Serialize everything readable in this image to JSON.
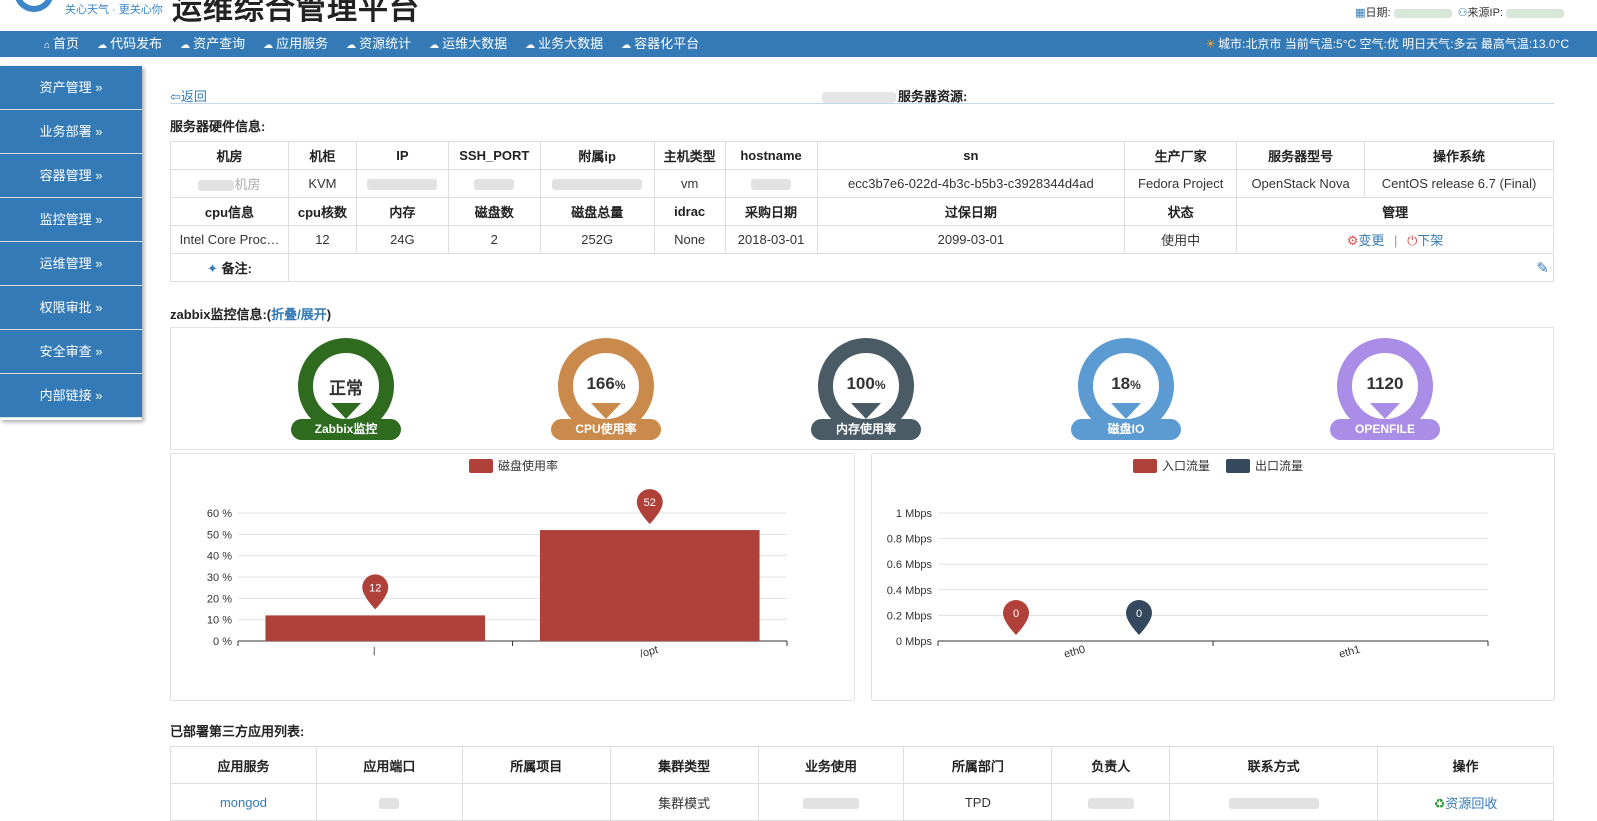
{
  "header": {
    "slogan": "关心天气 · 更关心你",
    "title": "运维综合管理平台",
    "date_label": "日期:",
    "ip_label": "来源IP:"
  },
  "nav": [
    {
      "label": "首页",
      "icon": "home-icon"
    },
    {
      "label": "代码发布",
      "icon": "cloud-icon"
    },
    {
      "label": "资产查询",
      "icon": "cloud-icon"
    },
    {
      "label": "应用服务",
      "icon": "cloud-icon"
    },
    {
      "label": "资源统计",
      "icon": "cloud-icon"
    },
    {
      "label": "运维大数据",
      "icon": "cloud-icon"
    },
    {
      "label": "业务大数据",
      "icon": "cloud-icon"
    },
    {
      "label": "容器化平台",
      "icon": "cloud-icon"
    }
  ],
  "weather": "城市:北京市  当前气温:5°C  空气:优  明日天气:多云  最高气温:13.0°C",
  "sidebar": [
    {
      "label": "资产管理"
    },
    {
      "label": "业务部署"
    },
    {
      "label": "容器管理"
    },
    {
      "label": "监控管理"
    },
    {
      "label": "运维管理"
    },
    {
      "label": "权限审批"
    },
    {
      "label": "安全审查"
    },
    {
      "label": "内部链接"
    }
  ],
  "back": "返回",
  "resource_title": "服务器资源:",
  "hw": {
    "title": "服务器硬件信息:",
    "h1": [
      "机房",
      "机柜",
      "IP",
      "SSH_PORT",
      "附属ip",
      "主机类型",
      "hostname",
      "sn",
      "生产厂家",
      "服务器型号",
      "操作系统"
    ],
    "r1": {
      "room_suffix": "机房",
      "cabinet": "KVM",
      "type": "vm",
      "sn": "ecc3b7e6-022d-4b3c-b5b3-c3928344d4ad",
      "vendor": "Fedora Project",
      "model": "OpenStack Nova",
      "os": "CentOS release 6.7 (Final)"
    },
    "h2": [
      "cpu信息",
      "cpu核数",
      "内存",
      "磁盘数",
      "磁盘总量",
      "idrac",
      "采购日期",
      "过保日期",
      "状态",
      "管理"
    ],
    "r2": {
      "cpu": "Intel Core Proc…",
      "cores": "12",
      "mem": "24G",
      "disks": "2",
      "disk_total": "252G",
      "idrac": "None",
      "buy": "2018-03-01",
      "warranty": "2099-03-01",
      "status": "使用中",
      "change": "变更",
      "offline": "下架"
    },
    "note": "备注:"
  },
  "zabbix": {
    "title": "zabbix监控信息:(",
    "toggle": "折叠/展开",
    "close": ")"
  },
  "gauges": [
    {
      "value": "正常",
      "unit": "",
      "label": "Zabbix监控",
      "color": "#2e6b1f"
    },
    {
      "value": "166",
      "unit": "%",
      "label": "CPU使用率",
      "color": "#c98a4b"
    },
    {
      "value": "100",
      "unit": "%",
      "label": "内存使用率",
      "color": "#4a5b66"
    },
    {
      "value": "18",
      "unit": "%",
      "label": "磁盘IO",
      "color": "#5b9bd1"
    },
    {
      "value": "1120",
      "unit": "",
      "label": "OPENFILE",
      "color": "#a98de6"
    }
  ],
  "chart_data": [
    {
      "type": "bar",
      "categories": [
        "/",
        "/opt"
      ],
      "series": [
        {
          "name": "磁盘使用率",
          "values": [
            12,
            52
          ],
          "color": "#b0403a"
        }
      ],
      "ylim": [
        0,
        60
      ],
      "yticks": [
        "0 %",
        "10 %",
        "20 %",
        "30 %",
        "40 %",
        "50 %",
        "60 %"
      ],
      "legend": "top-center",
      "grid": true
    },
    {
      "type": "bar",
      "categories": [
        "eth0",
        "eth1"
      ],
      "series": [
        {
          "name": "入口流量",
          "values": [
            0
          ],
          "color": "#b0403a"
        },
        {
          "name": "出口流量",
          "values": [
            0
          ],
          "color": "#34495e"
        }
      ],
      "ylim": [
        0,
        1
      ],
      "yticks": [
        "0 Mbps",
        "0.2 Mbps",
        "0.4 Mbps",
        "0.6 Mbps",
        "0.8 Mbps",
        "1 Mbps"
      ],
      "legend": "top-center",
      "grid": true
    }
  ],
  "apps": {
    "title": "已部署第三方应用列表:",
    "headers": [
      "应用服务",
      "应用端口",
      "所属项目",
      "集群类型",
      "业务使用",
      "所属部门",
      "负责人",
      "联系方式",
      "操作"
    ],
    "row": {
      "service": "mongod",
      "cluster": "集群模式",
      "dept": "TPD",
      "action": "资源回收"
    }
  }
}
